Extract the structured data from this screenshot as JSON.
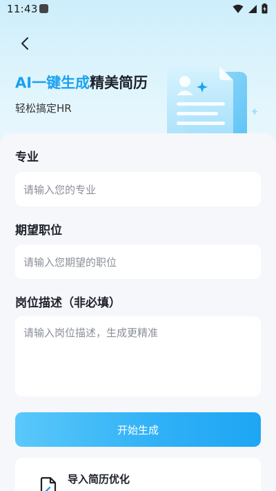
{
  "status_bar": {
    "time": "11:43"
  },
  "header": {
    "title_highlight": "AI一键生成",
    "title_rest": "精美简历",
    "subtitle": "轻松搞定HR"
  },
  "form": {
    "major": {
      "label": "专业",
      "placeholder": "请输入您的专业"
    },
    "position": {
      "label": "期望职位",
      "placeholder": "请输入您期望的职位"
    },
    "description": {
      "label": "岗位描述（非必填）",
      "placeholder": "请输入岗位描述，生成更精准"
    },
    "submit_label": "开始生成"
  },
  "import": {
    "title": "导入简历优化"
  },
  "colors": {
    "accent": "#1aa1f0",
    "button_start": "#5ac8fa",
    "button_end": "#1ea6f4"
  }
}
